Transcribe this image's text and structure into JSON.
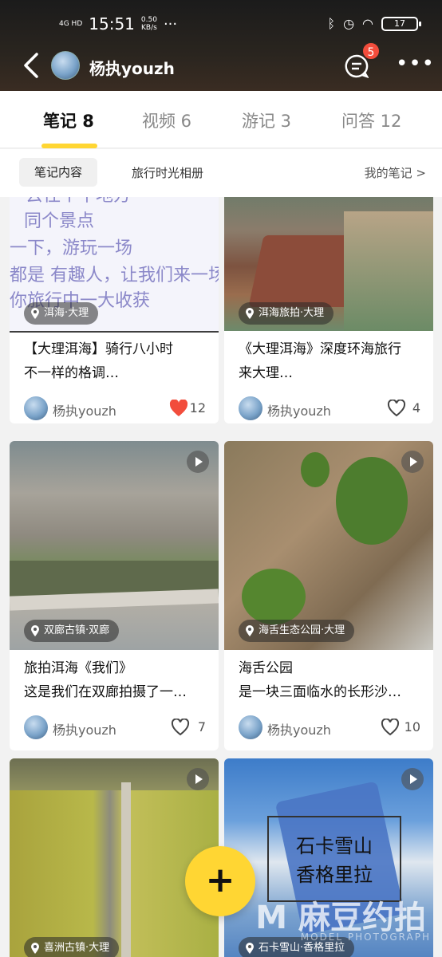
{
  "status_bar": {
    "signal": "4G HD",
    "time": "15:51",
    "speed_value": "0.50",
    "speed_unit": "KB/s",
    "dots": "···",
    "battery": "17"
  },
  "header": {
    "username": "杨执youzh",
    "badge_count": "5",
    "more": "•••"
  },
  "tabs": [
    {
      "label": "笔记 8",
      "active": true
    },
    {
      "label": "视频 6",
      "active": false
    },
    {
      "label": "游记 3",
      "active": false
    },
    {
      "label": "问答 12",
      "active": false
    }
  ],
  "subtabs": {
    "content": "笔记内容",
    "album": "旅行时光相册",
    "my_notes": "我的笔记 >"
  },
  "text_card_lines": [
    "去往个平地方",
    "同个景点",
    "一下，游玩一场",
    "都是 有趣人，让我们来一场",
    "你旅行中一大收获"
  ],
  "cards": [
    {
      "location": "洱海·大理",
      "title1": "【大理洱海】骑行八小时",
      "title2": "不一样的格调…",
      "author": "杨执youzh",
      "likes": "12",
      "liked": true
    },
    {
      "location": "洱海旅拍·大理",
      "title1": "《大理洱海》深度环海旅行",
      "title2": "来大理…",
      "author": "杨执youzh",
      "likes": "4",
      "liked": false
    },
    {
      "location": "双廊古镇·双廊",
      "title1": "旅拍洱海《我们》",
      "title2": "这是我们在双廊拍摄了一…",
      "author": "杨执youzh",
      "likes": "7",
      "liked": false
    },
    {
      "location": "海舌生态公园·大理",
      "title1": "海舌公园",
      "title2": "是一块三面临水的长形沙…",
      "author": "杨执youzh",
      "likes": "10",
      "liked": false
    },
    {
      "location": "喜洲古镇·大理"
    },
    {
      "location": "石卡雪山·香格里拉",
      "sticker_line1": "石卡雪山",
      "sticker_line2": "香格里拉"
    }
  ],
  "fab": "+",
  "watermark": {
    "line1": "M 麻豆约拍",
    "line2": "MODEL PHOTOGRAPH"
  },
  "colors": {
    "accent": "#ffd633",
    "like": "#f24d3c"
  }
}
